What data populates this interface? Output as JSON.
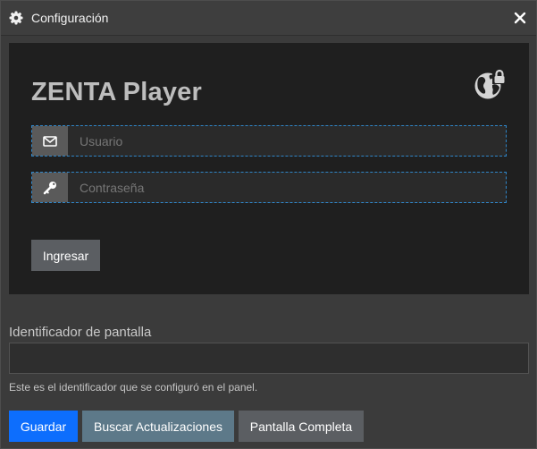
{
  "window": {
    "title": "Configuración",
    "icons": {
      "title_icon": "gear-icon",
      "close_icon": "close-icon"
    }
  },
  "login": {
    "app_title": "ZENTA Player",
    "status_icon": "globe-lock-icon",
    "username": {
      "placeholder": "Usuario",
      "value": "",
      "icon": "envelope-icon"
    },
    "password": {
      "placeholder": "Contraseña",
      "value": "",
      "icon": "key-icon"
    },
    "submit_label": "Ingresar"
  },
  "screen_id": {
    "label": "Identificador de pantalla",
    "value": "",
    "help": "Este es el identificador que se configuró en el panel."
  },
  "footer": {
    "save_label": "Guardar",
    "update_label": "Buscar Actualizaciones",
    "fullscreen_label": "Pantalla Completa"
  },
  "colors": {
    "primary": "#0d6efd",
    "info": "#5d7989",
    "secondary": "#5b5e62",
    "focus_outline": "#2f86c9",
    "panel_bg": "#1f1f1f",
    "window_bg": "#3b3b3b"
  }
}
